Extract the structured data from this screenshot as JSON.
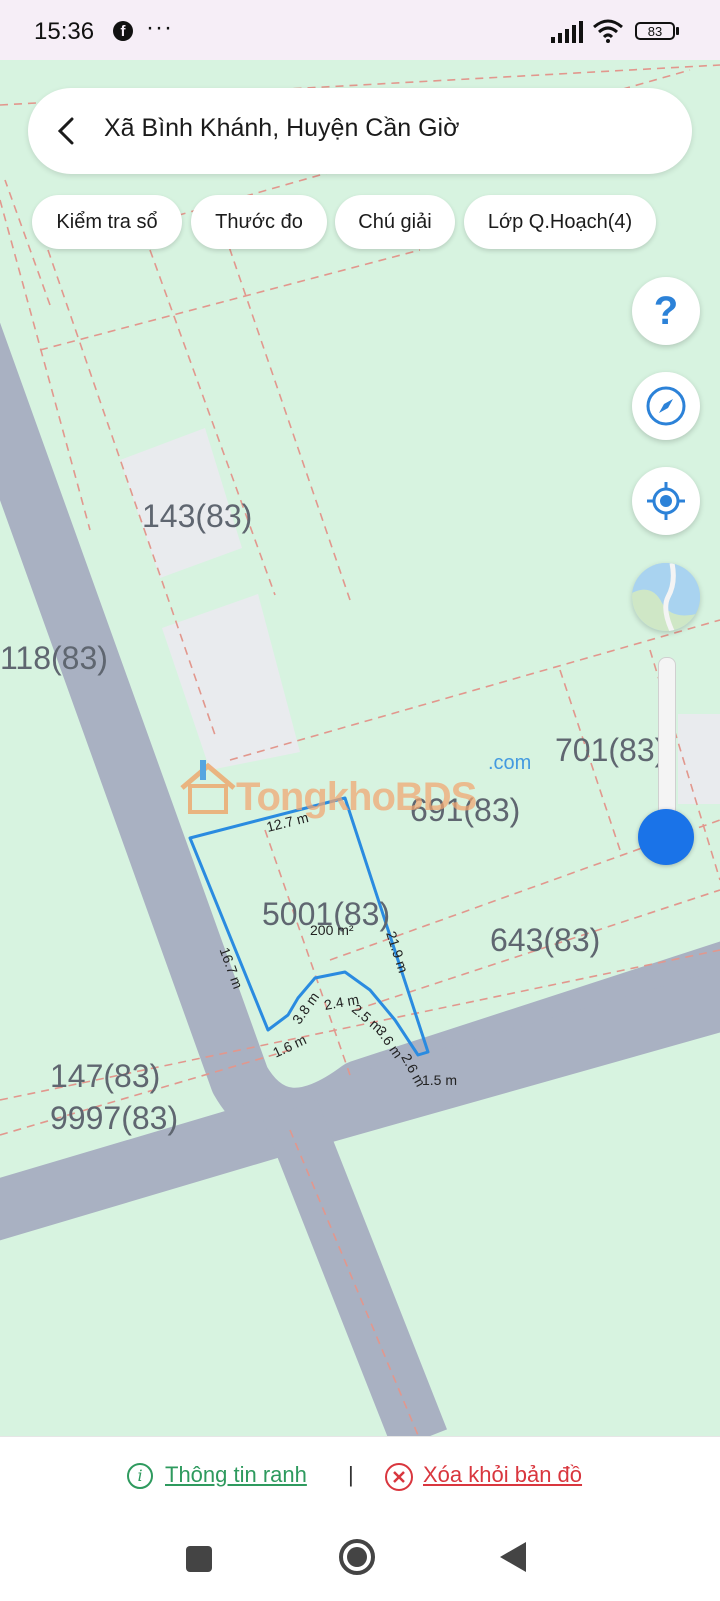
{
  "status_bar": {
    "time": "15:36",
    "dots": "···",
    "battery": "83"
  },
  "search": {
    "title": "Xã Bình Khánh, Huyện Cần Giờ"
  },
  "chips": [
    "Kiểm tra sổ",
    "Thước đo",
    "Chú giải",
    "Lớp Q.Hoạch(4)"
  ],
  "fab": {
    "help": "?"
  },
  "zoom": {
    "level": 0.9
  },
  "parcels": {
    "p143": "143(83)",
    "p118": "118(83)",
    "p701": "701(83)",
    "p691": "691(83)",
    "p5001": "5001(83)",
    "p643": "643(83)",
    "p147": "147(83)",
    "p9997": "9997(83)"
  },
  "measurements": {
    "area": "200 m²",
    "top": "12.7 m",
    "left": "16.7 m",
    "right": "21.9 m",
    "bottom": "1.5 m",
    "s1": "1.6 m",
    "s2": "3.8 m",
    "s3": "2.4 m",
    "s4": "2.5 m",
    "s5": "3.6 m",
    "s6": "2.6 m"
  },
  "watermark": {
    "main": "TongkhoBDS",
    "suffix": ".com"
  },
  "bottom": {
    "info": "Thông tin ranh",
    "separator": "|",
    "remove": "Xóa khỏi bản đồ"
  },
  "colors": {
    "map_bg": "#d7f3e0",
    "road": "#a9b1c2",
    "lot_line": "#e2978d",
    "parcel_outline": "#2a8be0",
    "info_green": "#2e9a5e",
    "remove_red": "#d9363e",
    "zoom_blue": "#1a73e8"
  }
}
